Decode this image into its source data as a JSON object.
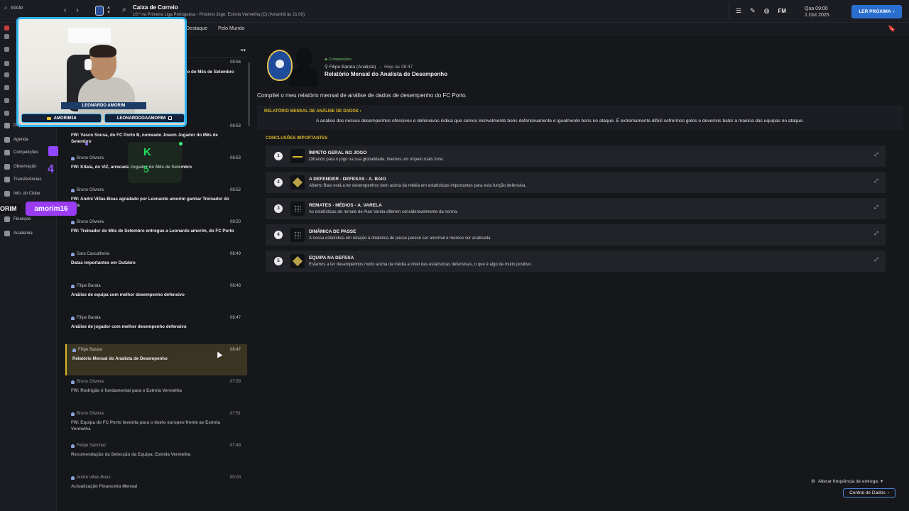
{
  "topbar": {
    "home_label": "Início",
    "title": "Caixa de Correio",
    "subtitle": "10.º na Primeira Liga Portuguesa - Próximo Jogo: Estrela Vermelha (C) (Amanhã às 21:00)",
    "fm_label": "FM",
    "date_line1": "Qua 09:00",
    "date_line2": "1 Out 2025",
    "next_button": "LER PRÓXIMA"
  },
  "subheader": {
    "tabs": [
      "Destaque",
      "Pelo Mundo"
    ]
  },
  "sidebar": {
    "items": [
      {
        "label": "Depto. Médico"
      },
      {
        "label": "Agenda"
      },
      {
        "label": "Competições"
      },
      {
        "label": "Observação"
      },
      {
        "label": "Transferências"
      },
      {
        "label": "Info. do Clube"
      },
      {
        "label": "Finanças"
      },
      {
        "label": "Academia"
      }
    ]
  },
  "stream": {
    "nameplate": "LEONARDO AMORIM",
    "tag_youtube": "AMORIM16",
    "tag_instagram": "LEONARDOOAAMORIM",
    "counter": "4",
    "k_letter": "K",
    "k_digit": "5",
    "amorim_left": "ORIM",
    "amorim_tag": "amorim16"
  },
  "inbox": {
    "messages": [
      {
        "from": "",
        "time": "08:56",
        "subject": "dio do Mês de Setembro",
        "read": false
      },
      {
        "from": "Bruno Oliveira",
        "time": "08:53",
        "subject": "FW: Vasco Sousa, do FC Porto B, nomeado Jovem Jogador do Mês de Setembro",
        "read": false
      },
      {
        "from": "Bruno Oliveira",
        "time": "08:53",
        "subject": "FW: Kitala, do VIZ, arrecada Jogador do Mês de Setembro",
        "read": false
      },
      {
        "from": "Bruno Oliveira",
        "time": "08:52",
        "subject": "FW: André Villas-Boas agradado por Leonardo amorim ganhar Treinador do Mês",
        "read": false
      },
      {
        "from": "Bruno Oliveira",
        "time": "08:50",
        "subject": "FW: Treinador do Mês de Setembro entregue a Leonardo amorim, do FC Porto",
        "read": false
      },
      {
        "from": "Sara Cascalheira",
        "time": "08:49",
        "subject": "Datas importantes em Outubro",
        "read": false
      },
      {
        "from": "Filipe Barata",
        "time": "08:48",
        "subject": "Análise de equipa com melhor desempenho defensivo",
        "read": false
      },
      {
        "from": "Filipe Barata",
        "time": "08:47",
        "subject": "Análise de jogador com melhor desempenho defensivo",
        "read": false
      },
      {
        "from": "Filipe Barata",
        "time": "08:47",
        "subject": "Relatório Mensal do Analista de Desempenho",
        "read": false,
        "selected": true
      },
      {
        "from": "Bruno Oliveira",
        "time": "07:59",
        "subject": "FW: Rodrigão é fundamental para o Estrela Vermelha",
        "read": true
      },
      {
        "from": "Bruno Oliveira",
        "time": "07:51",
        "subject": "FW: Equipa do FC Porto favorita para o duelo europeu frente ao Estrela Vermelha",
        "read": true
      },
      {
        "from": "Felipe Sánchez",
        "time": "07:49",
        "subject": "Recomendação da Selecção da Equipa: Estrela Vermelha",
        "read": true
      },
      {
        "from": "André Villas-Boas",
        "time": "00:00",
        "subject": "Actualização Financeira Mensal",
        "read": true
      }
    ]
  },
  "message": {
    "category": "Competições",
    "sender": "Filipe Barata (Analista)",
    "timestamp": "Hoje às 08:47",
    "heading": "Relatório Mensal do Analista de Desempenho",
    "intro": "Compilei o meu relatório mensal de análise de dados de desempenho do FC Porto.",
    "section_link": "RELATÓRIO MENSAL DE ANÁLISE DE DADOS ›",
    "section_text": "A análise dos nossos desempenhos ofensivos e defensivos indica que somos incrivelmente bons defensivamente e igualmente bons no ataque. É extremamente difícil sofrermos golos e devemos bater a maioria das equipas no ataque.",
    "conclusions_title": "CONCLUSÕES IMPORTANTES",
    "conclusions": [
      {
        "num": "1",
        "title": "ÍMPETO GERAL NO JOGO",
        "desc": "Olhando para o jogo na sua globalidade, tivemos um ímpeto mais forte.",
        "thumb": "line"
      },
      {
        "num": "2",
        "title": "A DEFENDER - DEFESAS - A. BAIO",
        "desc": "Alberto Baio está a ter desempenhos bem acima da média em estatísticas importantes para esta função defensiva.",
        "thumb": "gold"
      },
      {
        "num": "3",
        "title": "REMATES - MÉDIOS - A. VARELA",
        "desc": "As estatísticas de remate de Alan Varela diferem consideravelmente da norma.",
        "thumb": "dots"
      },
      {
        "num": "4",
        "title": "DINÂMICA DE PASSE",
        "desc": "A nossa estatística em relação à dinâmica de passe parece ser anormal e merece ser analisada.",
        "thumb": "dots"
      },
      {
        "num": "5",
        "title": "EQUIPA NA DEFESA",
        "desc": "Estamos a ter desempenhos muito acima da média a nível das estatísticas defensivas, o que é algo de muito positivo.",
        "thumb": "gold"
      }
    ],
    "frequency_label": "Alterar frequência de entrega",
    "central_label": "Central de Dados"
  }
}
